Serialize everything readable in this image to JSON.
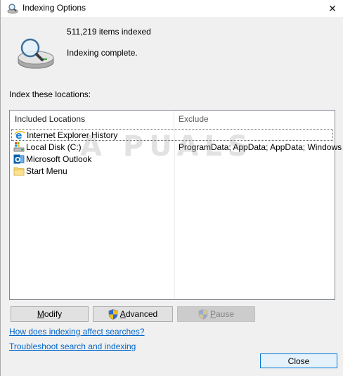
{
  "window": {
    "title": "Indexing Options",
    "close_glyph": "✕"
  },
  "summary": {
    "items_indexed": "511,219 items indexed",
    "status": "Indexing complete."
  },
  "locations": {
    "label": "Index these locations:",
    "columns": {
      "included": "Included Locations",
      "exclude": "Exclude"
    },
    "rows": [
      {
        "location": "Internet Explorer History",
        "exclude": "",
        "icon": "ie-icon"
      },
      {
        "location": "Local Disk (C:)",
        "exclude": "ProgramData; AppData; AppData; Windows",
        "icon": "local-disk-icon"
      },
      {
        "location": "Microsoft Outlook",
        "exclude": "",
        "icon": "outlook-icon"
      },
      {
        "location": "Start Menu",
        "exclude": "",
        "icon": "folder-icon"
      }
    ]
  },
  "buttons": {
    "modify_hot": "M",
    "modify_rest": "odify",
    "advanced_hot": "A",
    "advanced_rest": "dvanced",
    "pause_hot": "P",
    "pause_rest": "ause",
    "close": "Close"
  },
  "links": {
    "help": "How does indexing affect searches?",
    "troubleshoot": "Troubleshoot search and indexing"
  },
  "watermark": "A PUALS",
  "colors": {
    "link": "#0066cc",
    "close_button_border": "#0078d7",
    "window_bg": "#f0f0f0"
  }
}
